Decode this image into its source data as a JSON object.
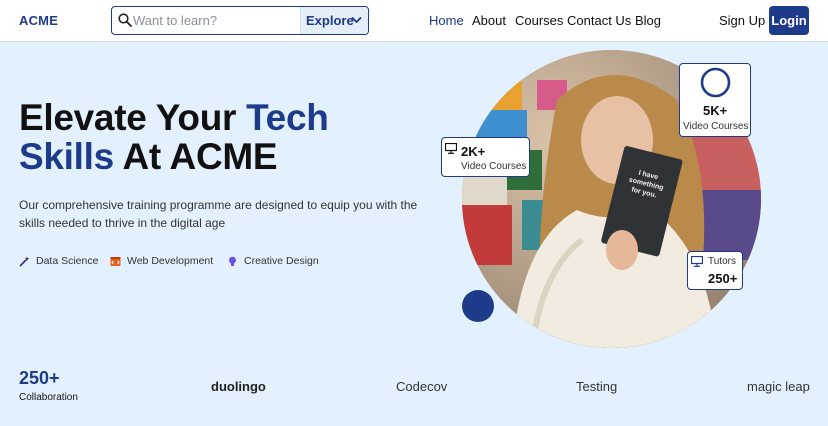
{
  "header": {
    "logo": "ACME",
    "search": {
      "placeholder": "Want to learn?",
      "explore_label": "Explore"
    },
    "nav": [
      "Home",
      "About",
      "Courses",
      "Contact Us",
      "Blog"
    ],
    "active_nav": "Home",
    "signup_label": "Sign Up",
    "login_label": "Login"
  },
  "hero": {
    "headline_part1": "Elevate Your ",
    "headline_accent1": "Tech",
    "headline_accent2": "Skills",
    "headline_part2": " At ACME",
    "subtext": "Our comprehensive training programme are designed to equip you with the skills needed to thrive in the digital age",
    "categories": [
      {
        "label": "Data Science",
        "icon": "magic-wand-icon"
      },
      {
        "label": "Web Development",
        "icon": "code-window-icon"
      },
      {
        "label": "Creative Design",
        "icon": "lightbulb-icon"
      }
    ]
  },
  "cards": {
    "video_courses_2k": {
      "value": "2K+",
      "label": "Video Courses",
      "icon": "monitor-icon"
    },
    "video_courses_5k": {
      "value": "5K+",
      "label": "Video Courses",
      "icon": "circle-icon"
    },
    "tutors": {
      "value": "250+",
      "label": "Tutors",
      "icon": "monitor-icon"
    }
  },
  "photo": {
    "book_text": "I have something for you."
  },
  "stats": {
    "collaboration_value": "250+",
    "collaboration_label": "Collaboration",
    "partners": [
      "duolingo",
      "Codecov",
      "Testing",
      "magic leap"
    ]
  },
  "colors": {
    "accent": "#1e3a8a",
    "background": "#e2f1fd"
  }
}
